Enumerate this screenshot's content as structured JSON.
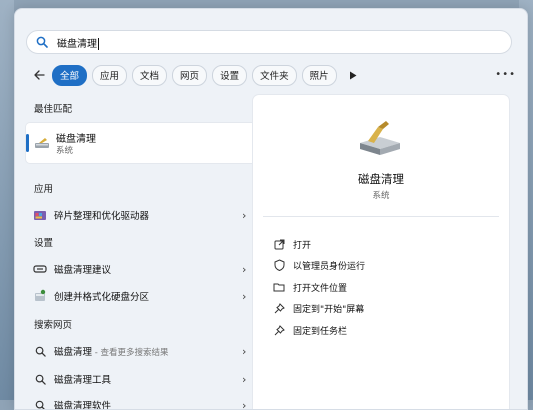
{
  "search": {
    "query": "磁盘清理"
  },
  "filters": {
    "tabs": [
      "全部",
      "应用",
      "文档",
      "网页",
      "设置",
      "文件夹",
      "照片"
    ],
    "active_index": 0
  },
  "best_match": {
    "header": "最佳匹配",
    "title": "磁盘清理",
    "subtitle": "系统"
  },
  "apps": {
    "header": "应用",
    "items": [
      {
        "label": "碎片整理和优化驱动器",
        "icon": "defrag-icon"
      }
    ]
  },
  "settings": {
    "header": "设置",
    "items": [
      {
        "label": "磁盘清理建议",
        "icon": "storage-icon"
      },
      {
        "label": "创建并格式化硬盘分区",
        "icon": "disk-partition-icon"
      }
    ]
  },
  "web": {
    "header": "搜索网页",
    "items": [
      {
        "label": "磁盘清理",
        "suffix": " - 查看更多搜索结果",
        "icon": "search-icon"
      },
      {
        "label": "磁盘清理工具",
        "suffix": "",
        "icon": "search-icon"
      },
      {
        "label": "磁盘清理软件",
        "suffix": "",
        "icon": "search-icon"
      }
    ]
  },
  "details": {
    "title": "磁盘清理",
    "subtitle": "系统",
    "actions": [
      {
        "label": "打开",
        "icon": "open-icon"
      },
      {
        "label": "以管理员身份运行",
        "icon": "shield-icon"
      },
      {
        "label": "打开文件位置",
        "icon": "folder-icon"
      },
      {
        "label": "固定到\"开始\"屏幕",
        "icon": "pin-icon"
      },
      {
        "label": "固定到任务栏",
        "icon": "pin-icon"
      }
    ]
  },
  "colors": {
    "accent": "#1f6fc5",
    "panel_bg": "#eef2f7"
  }
}
